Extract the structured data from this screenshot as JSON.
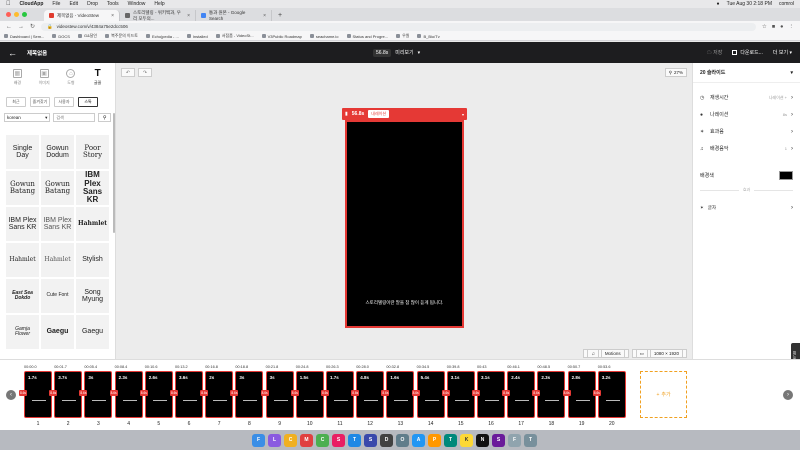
{
  "menubar": {
    "apple": "",
    "app": "CloudApp",
    "items": [
      "File",
      "Edit",
      "Drop",
      "Tools",
      "Window",
      "Help"
    ],
    "clock": "Tue Aug 30  2:18 PM",
    "user": "comrol"
  },
  "browser": {
    "tabs": [
      {
        "label": "제목없음 - VideoStew",
        "active": true
      },
      {
        "label": "스토리텔링 - 위키백과, 우리 모두의...",
        "active": false
      },
      {
        "label": "통과 원본 - Google Search",
        "active": false
      }
    ],
    "new_tab": "+",
    "url": "videostew.com/v/4384a75e2dcc506",
    "bookmarks": [
      "Dashboard | Sem...",
      "DOCS",
      "G&달인",
      "복주문의 이드토",
      "Echo|pedia - ...",
      "Installed",
      "서점품 - VideoSt...",
      "V3Public Roadmap",
      "seachame.io",
      "Status and Progre...",
      "우원",
      "B_Bio/Tv"
    ]
  },
  "header": {
    "back_icon": "arrow-left-icon",
    "title": "제목없음",
    "duration": "56.8s",
    "preview": "미리보기",
    "save": "저장",
    "download": "다운로드...",
    "more": "더 보기"
  },
  "left": {
    "categories": [
      {
        "label": "배경",
        "icon": "grid"
      },
      {
        "label": "이미지",
        "icon": "image"
      },
      {
        "label": "도형",
        "icon": "shape"
      },
      {
        "label": "글꼴",
        "icon": "text"
      }
    ],
    "filters": [
      "최근",
      "즐겨찾기",
      "사용자",
      "스톡"
    ],
    "active_filter": "스톡",
    "language": "korean",
    "search_placeholder": "검색",
    "fonts": [
      "Single Day",
      "Gowun Dodum",
      "Poor Story",
      "Gowun Batang",
      "Gowun Batang",
      "IBM Plex Sans KR",
      "IBM Plex Sans KR",
      "IBM Plex Sans KR",
      "Hahmlet",
      "Hahmlet",
      "Hahmlet",
      "Stylish",
      "East Sea Dokdo",
      "Cute Font",
      "Song Myung",
      "Gamja Flower",
      "Gaegu",
      "Gaegu"
    ]
  },
  "canvas": {
    "zoom": "27%",
    "slide_duration": "56.8s",
    "slide_tag": "내레이션",
    "caption": "스토리텔링이란 말을 참 많이 듣게 됩니다.",
    "motions": "Motions",
    "resolution": "1080 × 1920"
  },
  "right": {
    "title": "20 슬라이드",
    "rows": [
      {
        "icon": "clock",
        "label": "재생시간",
        "value": "나레이션 +"
      },
      {
        "icon": "person",
        "label": "나레이션",
        "value": "8s"
      },
      {
        "icon": "sparkle",
        "label": "효과음",
        "value": ""
      },
      {
        "icon": "note",
        "label": "배경음악",
        "value": "1"
      }
    ],
    "bg_label": "배경색",
    "bg_color": "#000000",
    "divider": "효과",
    "sticker": "글자"
  },
  "side_tab": "피드백",
  "timeline": {
    "clips": [
      {
        "ts": "00:00.0",
        "dur": "1.7s"
      },
      {
        "ts": "00:01.7",
        "dur": "3.7s"
      },
      {
        "ts": "00:05.4",
        "dur": "3s"
      },
      {
        "ts": "00:08.4",
        "dur": "2.3s"
      },
      {
        "ts": "00:10.6",
        "dur": "2.6s"
      },
      {
        "ts": "00:13.2",
        "dur": "3.6s"
      },
      {
        "ts": "00:16.8",
        "dur": "2s"
      },
      {
        "ts": "00:18.8",
        "dur": "3s"
      },
      {
        "ts": "00:21.8",
        "dur": "3s"
      },
      {
        "ts": "00:24.8",
        "dur": "1.5s"
      },
      {
        "ts": "00:26.3",
        "dur": "1.7s"
      },
      {
        "ts": "00:28.0",
        "dur": "4.8s"
      },
      {
        "ts": "00:32.8",
        "dur": "1.6s"
      },
      {
        "ts": "00:34.5",
        "dur": "5.4s"
      },
      {
        "ts": "00:39.8",
        "dur": "3.1s"
      },
      {
        "ts": "00:43",
        "dur": "3.1s"
      },
      {
        "ts": "00:46.1",
        "dur": "2.4s"
      },
      {
        "ts": "00:48.5",
        "dur": "2.3s"
      },
      {
        "ts": "00:50.7",
        "dur": "2.8s"
      },
      {
        "ts": "00:53.6",
        "dur": "3.2s"
      }
    ],
    "badge": "8.6s",
    "add": "추가"
  },
  "dock": [
    {
      "label": "F",
      "color": "#3a8ee6"
    },
    {
      "label": "L",
      "color": "#8a5ae0"
    },
    {
      "label": "C",
      "color": "#f0b020"
    },
    {
      "label": "M",
      "color": "#e04040"
    },
    {
      "label": "C",
      "color": "#4caf50"
    },
    {
      "label": "S",
      "color": "#e91e63"
    },
    {
      "label": "T",
      "color": "#1e88e5"
    },
    {
      "label": "S",
      "color": "#3949ab"
    },
    {
      "label": "D",
      "color": "#424242"
    },
    {
      "label": "O",
      "color": "#607d8b"
    },
    {
      "label": "A",
      "color": "#2196f3"
    },
    {
      "label": "P",
      "color": "#ff9800"
    },
    {
      "label": "T",
      "color": "#00897b"
    },
    {
      "label": "K",
      "color": "#fdd835"
    },
    {
      "label": "N",
      "color": "#111111"
    },
    {
      "label": "S",
      "color": "#6a1b9a"
    },
    {
      "label": "F",
      "color": "#90a4ae"
    },
    {
      "label": "T",
      "color": "#78909c"
    }
  ]
}
